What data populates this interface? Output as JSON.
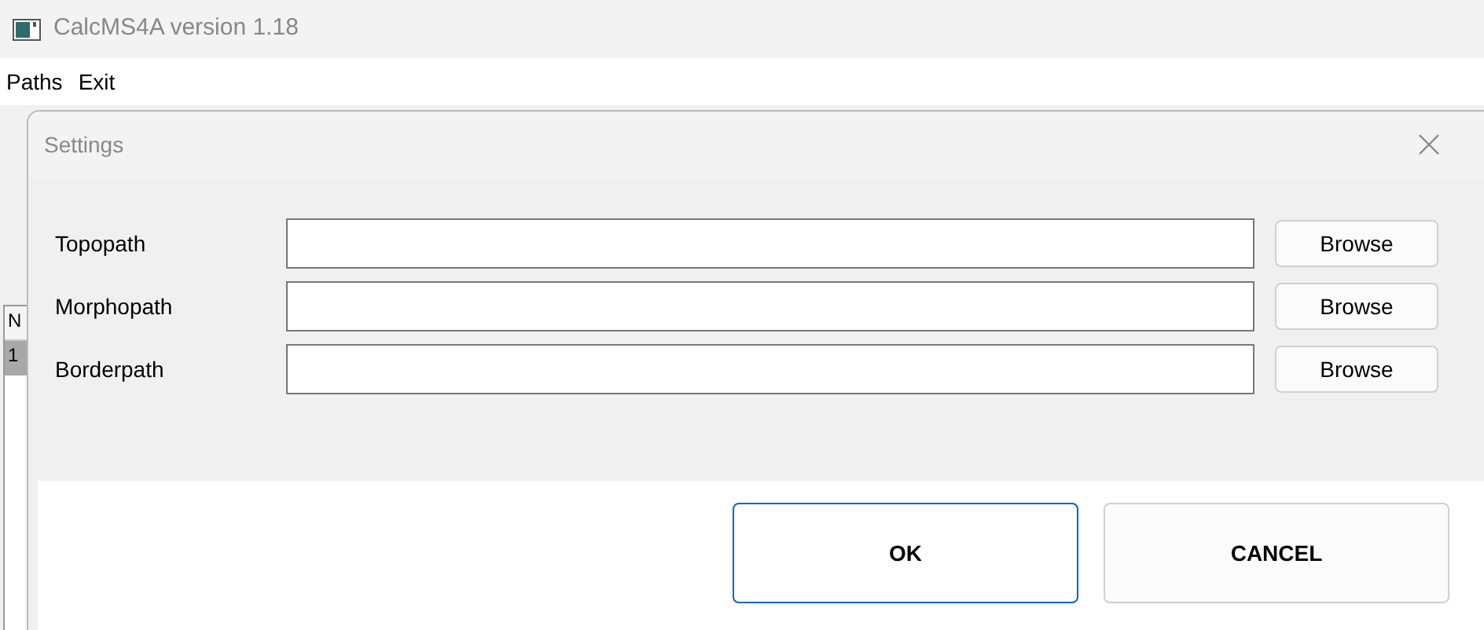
{
  "window": {
    "title": "CalcMS4A version 1.18"
  },
  "menu": [
    "Paths",
    "Exit"
  ],
  "background_table": {
    "column_1": "N",
    "row_1": "1"
  },
  "dialog": {
    "title": "Settings",
    "fields": [
      {
        "label": "Topopath",
        "button": "Browse"
      },
      {
        "label": "Morphopath",
        "button": "Browse"
      },
      {
        "label": "Borderpath",
        "button": "Browse"
      }
    ],
    "buttons": [
      {
        "label": "OK",
        "selected": true
      },
      {
        "label": "CANCEL",
        "selected": false
      }
    ]
  }
}
